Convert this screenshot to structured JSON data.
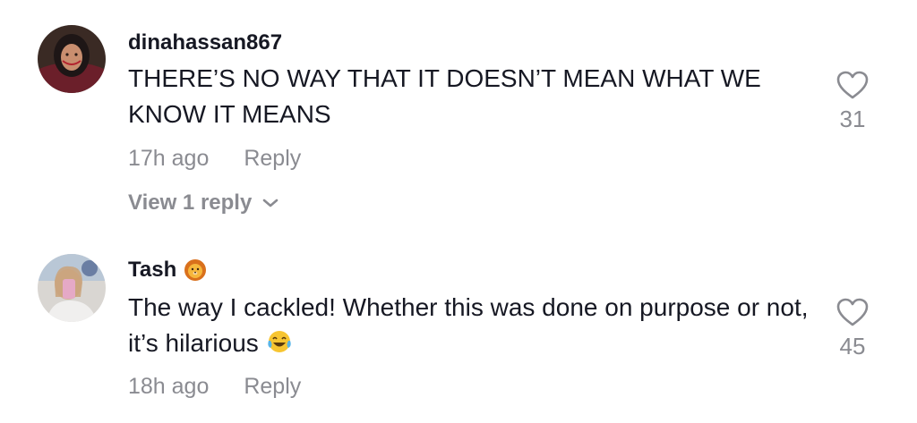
{
  "comments": [
    {
      "username": "dinahassan867",
      "text": "THERE’S NO WAY THAT IT DOESN’T MEAN WHAT WE KNOW IT MEANS",
      "time": "17h ago",
      "reply_label": "Reply",
      "likes": "31",
      "view_replies": "View 1 reply",
      "avatar_icon": "profile-photo"
    },
    {
      "username": "Tash",
      "username_emoji": "lion-face-icon",
      "text": "The way I cackled! Whether this was done on purpose or not, it’s hilarious",
      "trailing_emoji": "tears-of-joy-emoji-icon",
      "time": "18h ago",
      "reply_label": "Reply",
      "likes": "45",
      "avatar_icon": "profile-photo"
    }
  ],
  "colors": {
    "primary_text": "#161823",
    "secondary_text": "#8a8b91",
    "background": "#ffffff"
  }
}
